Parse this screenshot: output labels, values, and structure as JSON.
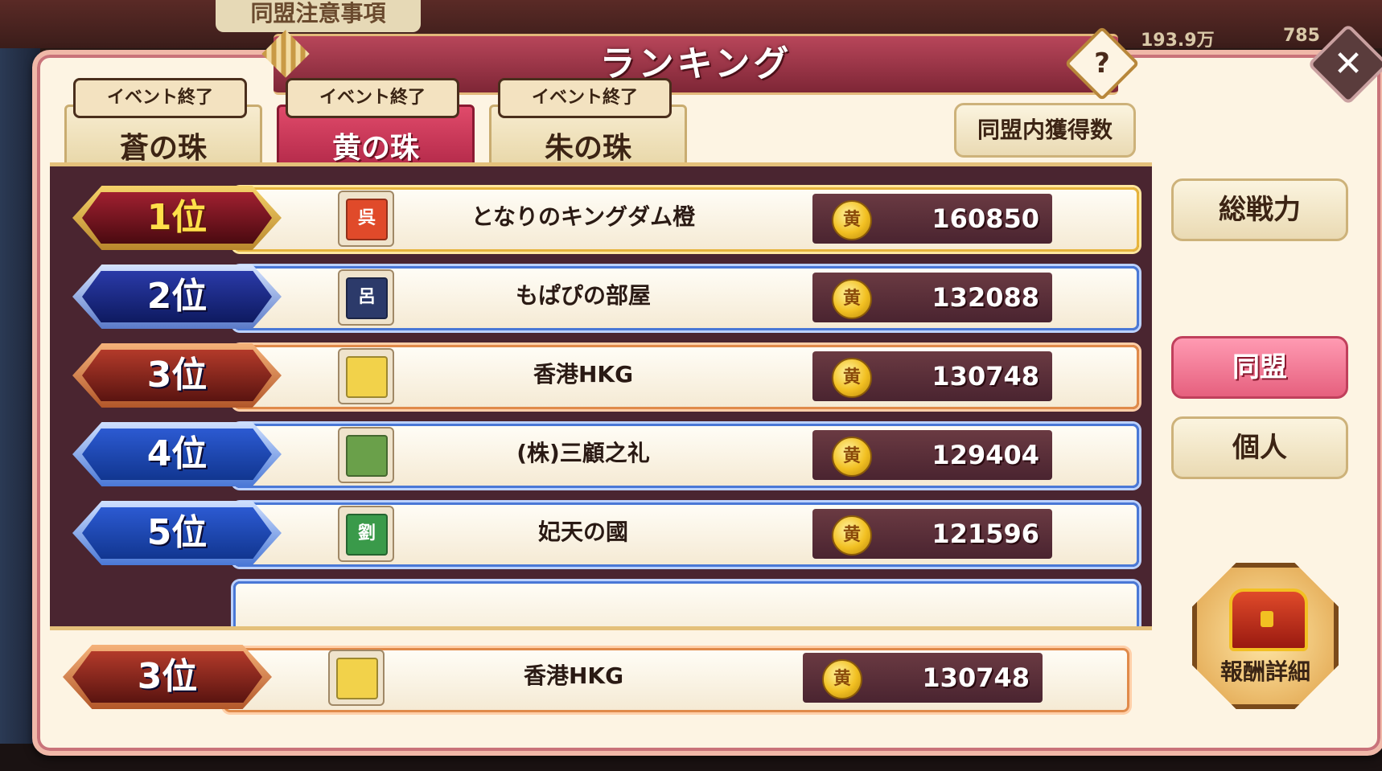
{
  "background": {
    "notice_label": "同盟注意事項",
    "stat1": "193.9万",
    "stat2": "785"
  },
  "title": "ランキング",
  "help_label": "?",
  "close_label": "✕",
  "tabs": [
    {
      "badge": "イベント終了",
      "label": "蒼の珠",
      "active": false
    },
    {
      "badge": "イベント終了",
      "label": "黄の珠",
      "active": true
    },
    {
      "badge": "イベント終了",
      "label": "朱の珠",
      "active": false
    }
  ],
  "stat_button": "同盟内獲得数",
  "coin_glyph": "黄",
  "rankings": [
    {
      "rank": "1位",
      "name": "となりのキングダム橙",
      "score": "160850",
      "flag_glyph": "呉",
      "flag_color": "#e04a2a"
    },
    {
      "rank": "2位",
      "name": "もぱぴの部屋",
      "score": "132088",
      "flag_glyph": "呂",
      "flag_color": "#2c3a6a"
    },
    {
      "rank": "3位",
      "name": "香港HKG",
      "score": "130748",
      "flag_glyph": "",
      "flag_color": "#f2d24a"
    },
    {
      "rank": "4位",
      "name": "(株)三顧之礼",
      "score": "129404",
      "flag_glyph": "",
      "flag_color": "#6aa04a"
    },
    {
      "rank": "5位",
      "name": "妃天の國",
      "score": "121596",
      "flag_glyph": "劉",
      "flag_color": "#3a9a4a"
    }
  ],
  "my_rank": {
    "rank": "3位",
    "name": "香港HKG",
    "score": "130748",
    "flag_glyph": "",
    "flag_color": "#f2d24a"
  },
  "side_buttons": {
    "total_power": "総戦力",
    "alliance": "同盟",
    "individual": "個人",
    "reward_detail": "報酬詳細"
  }
}
